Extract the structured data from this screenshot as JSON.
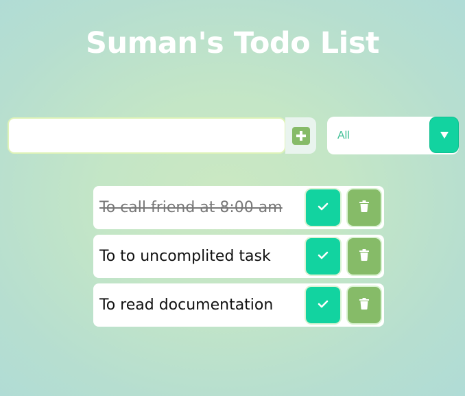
{
  "header": {
    "title": "Suman's Todo List"
  },
  "form": {
    "input_value": "",
    "input_placeholder": "",
    "add_icon": "plus-square-icon",
    "filter": {
      "selected": "All",
      "arrow_icon": "caret-down-icon"
    }
  },
  "todos": [
    {
      "text": "To call friend at 8:00 am",
      "completed": true
    },
    {
      "text": "To to uncomplited task",
      "completed": false
    },
    {
      "text": "To read documentation",
      "completed": false
    }
  ],
  "colors": {
    "accent_green": "#12d3a0",
    "trash_green": "#86bb68",
    "title": "#ffffff"
  }
}
